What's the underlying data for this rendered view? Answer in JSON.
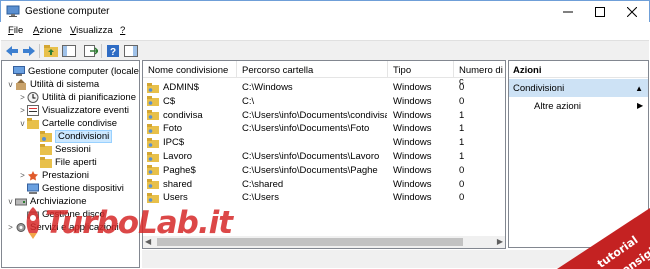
{
  "window": {
    "title": "Gestione computer"
  },
  "menu": [
    {
      "label": "File",
      "accel": "F",
      "rest": "ile"
    },
    {
      "label": "Azione",
      "accel": "A",
      "rest": "zione"
    },
    {
      "label": "Visualizza",
      "accel": "V",
      "rest": "isualizza"
    },
    {
      "label": "?",
      "accel": "?",
      "rest": ""
    }
  ],
  "tree": [
    {
      "label": "Gestione computer (locale)",
      "icon": "computer-icon",
      "level": 0,
      "expander": ""
    },
    {
      "label": "Utilità di sistema",
      "icon": "tools-icon",
      "level": 1,
      "expander": "v"
    },
    {
      "label": "Utilità di pianificazione",
      "icon": "clock-icon",
      "level": 2,
      "expander": ">"
    },
    {
      "label": "Visualizzatore eventi",
      "icon": "event-viewer-icon",
      "level": 2,
      "expander": ">"
    },
    {
      "label": "Cartelle condivise",
      "icon": "shared-folder-icon",
      "level": 2,
      "expander": "v"
    },
    {
      "label": "Condivisioni",
      "icon": "share-icon",
      "level": 3,
      "expander": "",
      "selected": true
    },
    {
      "label": "Sessioni",
      "icon": "session-icon",
      "level": 3,
      "expander": ""
    },
    {
      "label": "File aperti",
      "icon": "open-file-icon",
      "level": 3,
      "expander": ""
    },
    {
      "label": "Prestazioni",
      "icon": "performance-icon",
      "level": 2,
      "expander": ">"
    },
    {
      "label": "Gestione dispositivi",
      "icon": "device-manager-icon",
      "level": 2,
      "expander": ""
    },
    {
      "label": "Archiviazione",
      "icon": "storage-icon",
      "level": 1,
      "expander": "v"
    },
    {
      "label": "Gestione disco",
      "icon": "disk-icon",
      "level": 2,
      "expander": ""
    },
    {
      "label": "Servizi e applicazioni",
      "icon": "services-icon",
      "level": 1,
      "expander": ">"
    }
  ],
  "list": {
    "columns": [
      "Nome condivisione",
      "Percorso cartella",
      "Tipo",
      "Numero di c"
    ],
    "rows": [
      {
        "name": "ADMIN$",
        "path": "C:\\Windows",
        "type": "Windows",
        "count": "0"
      },
      {
        "name": "C$",
        "path": "C:\\",
        "type": "Windows",
        "count": "0"
      },
      {
        "name": "condivisa",
        "path": "C:\\Users\\info\\Documents\\condivisa",
        "type": "Windows",
        "count": "1"
      },
      {
        "name": "Foto",
        "path": "C:\\Users\\info\\Documents\\Foto",
        "type": "Windows",
        "count": "1"
      },
      {
        "name": "IPC$",
        "path": "",
        "type": "Windows",
        "count": "1"
      },
      {
        "name": "Lavoro",
        "path": "C:\\Users\\info\\Documents\\Lavoro",
        "type": "Windows",
        "count": "1"
      },
      {
        "name": "Paghe$",
        "path": "C:\\Users\\info\\Documents\\Paghe",
        "type": "Windows",
        "count": "0"
      },
      {
        "name": "shared",
        "path": "C:\\shared",
        "type": "Windows",
        "count": "0"
      },
      {
        "name": "Users",
        "path": "C:\\Users",
        "type": "Windows",
        "count": "0"
      }
    ]
  },
  "actions": {
    "header": "Azioni",
    "group": "Condivisioni",
    "items": [
      "Altre azioni"
    ]
  },
  "watermark": {
    "text": "TurboLab.it",
    "badge_line1": "tutorial",
    "badge_line2": "consigli"
  },
  "colors": {
    "selection": "#cce8ff",
    "action_group": "#cde2f5",
    "watermark": "#d62828"
  }
}
